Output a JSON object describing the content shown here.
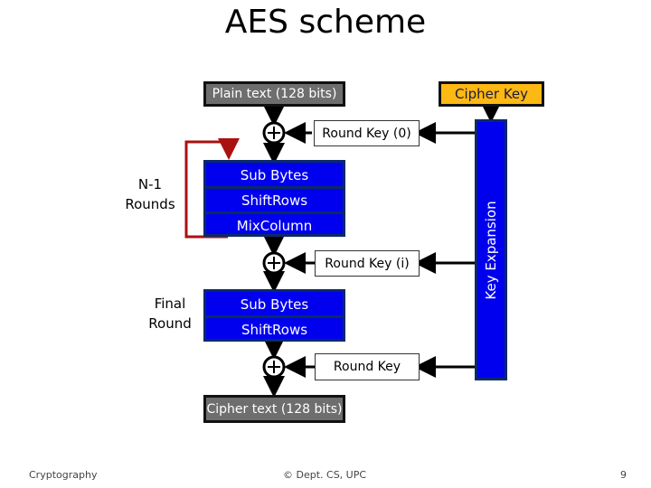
{
  "slide": {
    "title": "AES scheme",
    "footer": {
      "left": "Cryptography",
      "center": "© Dept. CS, UPC",
      "right": "9"
    }
  },
  "diagram": {
    "plaintext": "Plain text (128 bits)",
    "cipher_key": "Cipher Key",
    "key_expansion": "Key Expansion",
    "round_key_0": "Round Key (0)",
    "round_key_i": "Round Key (i)",
    "round_key_final": "Round Key",
    "main_rounds": {
      "label": "N-1\nRounds",
      "steps": [
        "Sub Bytes",
        "ShiftRows",
        "MixColumn"
      ]
    },
    "final_round": {
      "label": "Final\nRound",
      "steps": [
        "Sub Bytes",
        "ShiftRows"
      ]
    },
    "ciphertext": "Cipher text (128 bits)",
    "xor_symbol": "+",
    "colors": {
      "step_fill": "#0000ee",
      "io_fill": "#6e6e6e",
      "key_fill": "#fdb813",
      "loop_arrow": "#aa1111"
    }
  }
}
